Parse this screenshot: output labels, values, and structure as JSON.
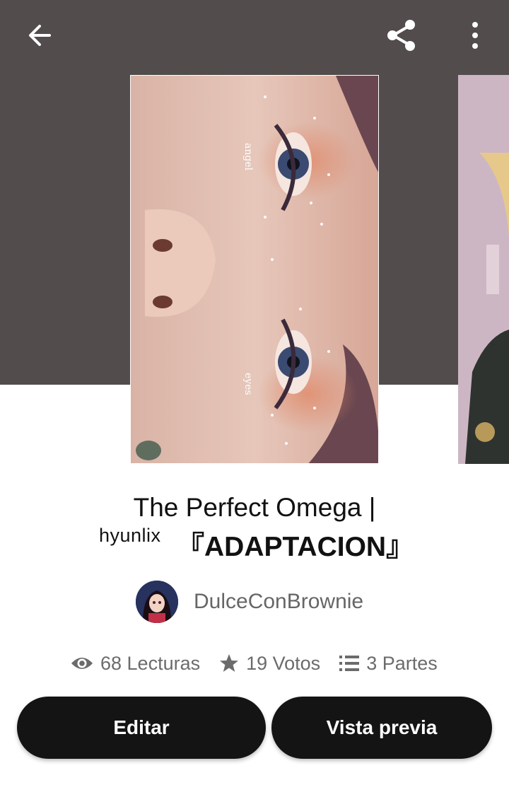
{
  "story": {
    "title_line1": "The Perfect Omega |",
    "title_tag": "hyunlix",
    "title_line2": "『ADAPTACION』",
    "author": "DulceConBrownie"
  },
  "cover": {
    "text_top": "angel",
    "text_bottom": "eyes"
  },
  "stats": {
    "reads": "68 Lecturas",
    "votes": "19 Votos",
    "parts": "3 Partes"
  },
  "actions": {
    "edit_label": "Editar",
    "preview_label": "Vista previa"
  },
  "icons": {
    "back": "arrow-left-icon",
    "share": "share-icon",
    "more": "more-vertical-icon",
    "reads": "eye-icon",
    "votes": "star-icon",
    "parts": "list-icon"
  },
  "colors": {
    "hero_background": "#524c4c",
    "button_background": "#141414",
    "stat_text": "#6b6b6b"
  }
}
